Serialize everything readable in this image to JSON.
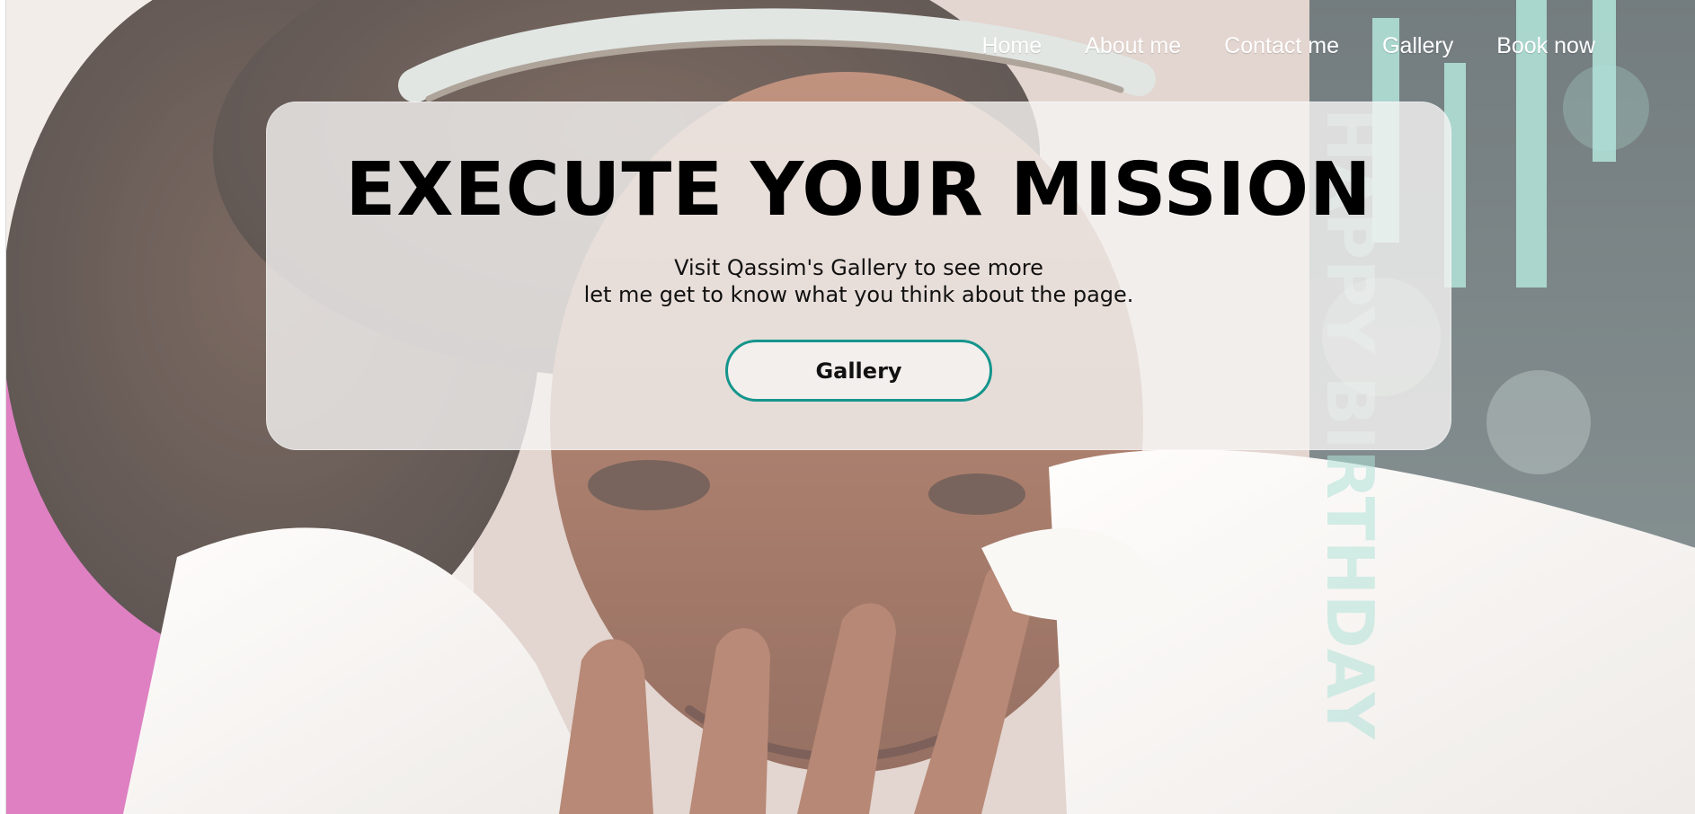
{
  "colors": {
    "nav_text": "#ffffff",
    "card_background": "rgba(245,244,243,0.80)",
    "button_border": "#15958c",
    "title_text": "#000000",
    "body_text": "#111111"
  },
  "background": {
    "decorative_text": "HAPPY BIRTHDAY"
  },
  "nav": {
    "items": [
      {
        "label": "Home"
      },
      {
        "label": "About me"
      },
      {
        "label": "Contact me"
      },
      {
        "label": "Gallery"
      },
      {
        "label": "Book now"
      }
    ]
  },
  "hero": {
    "title": "EXECUTE YOUR MISSION",
    "subtitle_line_1": "Visit Qassim's Gallery to see more",
    "subtitle_line_2": "let me get to know what you think about the page.",
    "button_label": "Gallery"
  }
}
